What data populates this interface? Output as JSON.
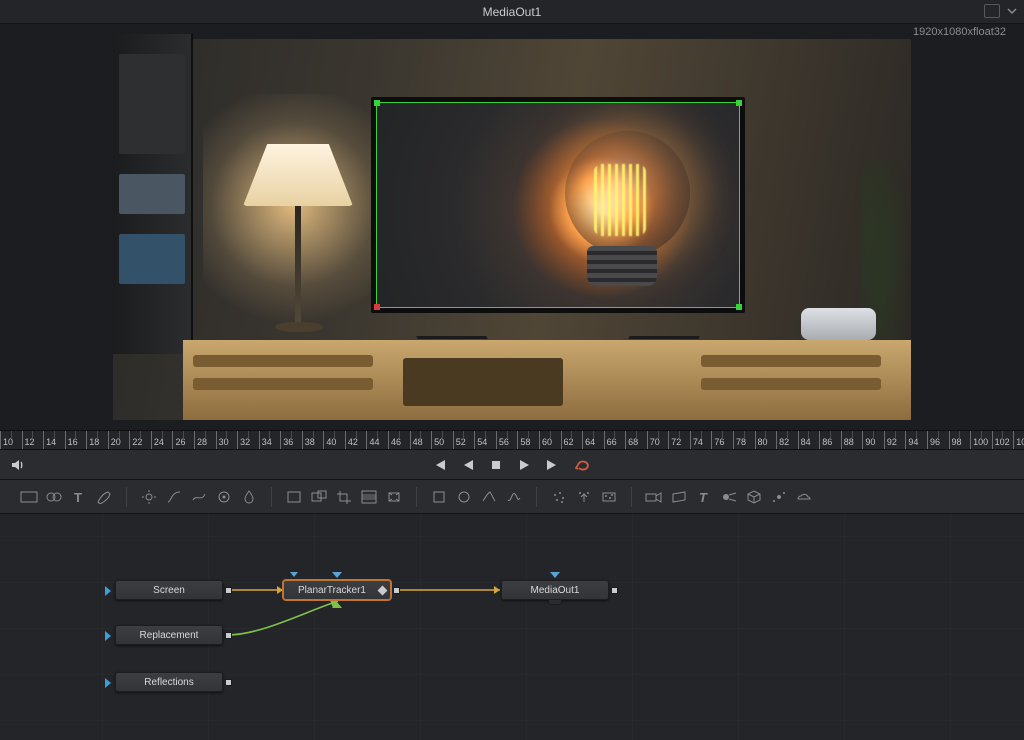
{
  "titlebar": {
    "title": "MediaOut1"
  },
  "viewer": {
    "resolution_label": "1920x1080xfloat32"
  },
  "ruler": {
    "start": 10,
    "end": 105,
    "step": 2
  },
  "transport": {
    "buttons": {
      "audio": "Audio",
      "first": "Go to first frame",
      "prev": "Play reverse",
      "stop": "Stop",
      "play": "Play forward",
      "last": "Go to last frame",
      "loop": "Loop"
    }
  },
  "toolbar": {
    "icons": [
      "background",
      "merge",
      "text",
      "paint",
      "brightness-contrast",
      "color-curves",
      "hue-curves",
      "color-corrector",
      "blur",
      "transform",
      "resize",
      "crop",
      "letterbox",
      "dve",
      "rectangle-mask",
      "ellipse-mask",
      "polygon-mask",
      "bspline-mask",
      "particles",
      "p-emitter",
      "p-render",
      "camera3d",
      "image-plane3d",
      "shape3d",
      "spot-light",
      "renderer3d",
      "lens-flare",
      "fog3d"
    ]
  },
  "flow": {
    "nodes": {
      "screen": {
        "label": "Screen"
      },
      "replacement": {
        "label": "Replacement"
      },
      "reflections": {
        "label": "Reflections"
      },
      "tracker": {
        "label": "PlanarTracker1"
      },
      "mediaout": {
        "label": "MediaOut1"
      }
    }
  }
}
